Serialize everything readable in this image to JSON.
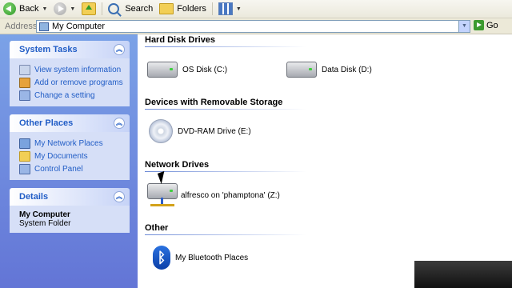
{
  "toolbar": {
    "back_label": "Back",
    "search_label": "Search",
    "folders_label": "Folders"
  },
  "address": {
    "label": "Address",
    "value": "My Computer",
    "go_label": "Go"
  },
  "left_pane": {
    "system_tasks": {
      "title": "System Tasks",
      "items": [
        "View system information",
        "Add or remove programs",
        "Change a setting"
      ]
    },
    "other_places": {
      "title": "Other Places",
      "items": [
        "My Network Places",
        "My Documents",
        "Control Panel"
      ]
    },
    "details": {
      "title": "Details",
      "name": "My Computer",
      "type": "System Folder"
    }
  },
  "sections": {
    "hard_disk": {
      "title": "Hard Disk Drives",
      "items": [
        "OS Disk (C:)",
        "Data Disk (D:)"
      ]
    },
    "removable": {
      "title": "Devices with Removable Storage",
      "items": [
        "DVD-RAM Drive (E:)"
      ]
    },
    "network": {
      "title": "Network Drives",
      "items": [
        "alfresco on 'phamptona' (Z:)"
      ]
    },
    "other": {
      "title": "Other",
      "items": [
        "My Bluetooth Places"
      ]
    }
  },
  "colors": {
    "left_pane_gradient_top": "#7ba2e7",
    "left_pane_gradient_bottom": "#6375d6",
    "link_blue": "#215dc6"
  }
}
